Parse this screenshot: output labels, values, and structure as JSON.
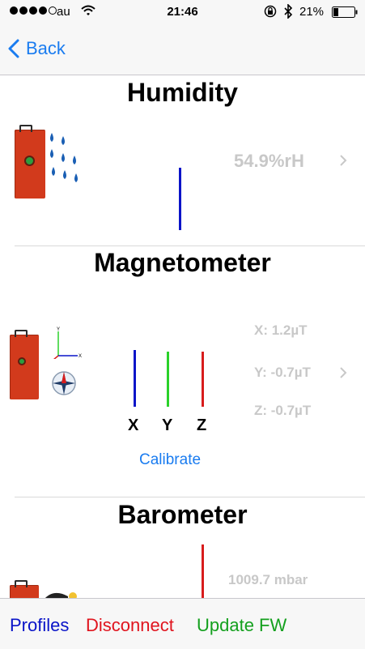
{
  "status_bar": {
    "carrier": "au",
    "time": "21:46",
    "battery_percent": "21%"
  },
  "nav": {
    "back_label": "Back"
  },
  "humidity": {
    "title": "Humidity",
    "value": "54.9%rH"
  },
  "magnetometer": {
    "title": "Magnetometer",
    "x_value": "X:  1.2µT",
    "y_value": "Y: -0.7µT",
    "z_value": "Z: -0.7µT",
    "axis_labels": [
      "X",
      "Y",
      "Z"
    ],
    "calibrate_label": "Calibrate",
    "bar_colors": [
      "#0a14c8",
      "#2ad12a",
      "#d81c1c"
    ]
  },
  "barometer": {
    "title": "Barometer",
    "value": "1009.7 mbar"
  },
  "tab_bar": {
    "profiles": "Profiles",
    "disconnect": "Disconnect",
    "update_fw": "Update FW"
  },
  "colors": {
    "accent": "#1a7cf0",
    "disconnect": "#e0141e",
    "update": "#14a01e"
  }
}
